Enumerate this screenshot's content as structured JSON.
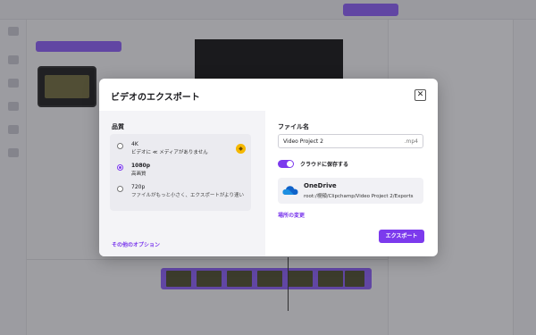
{
  "background_app": {
    "colors": {
      "accent": "#8b5cf6",
      "preview_bg": "#111111"
    }
  },
  "dialog": {
    "title": "ビデオのエクスポート",
    "close_icon": "close-icon",
    "quality": {
      "label": "品質",
      "options": [
        {
          "title": "4K",
          "subtitle": "ビデオに ≪ メディアがありません",
          "selected": false,
          "premium_icon": "premium-gem-icon"
        },
        {
          "title": "1080p",
          "subtitle": "高画質",
          "selected": true
        },
        {
          "title": "720p",
          "subtitle": "ファイルがもっと小さく、エクスポートがより速い",
          "selected": false
        }
      ],
      "more_options": "その他のオプション"
    },
    "filename": {
      "label": "ファイル名",
      "value": "Video Project 2",
      "extension": ".mp4"
    },
    "cloud_save": {
      "label": "クラウドに保存する",
      "enabled": true
    },
    "location": {
      "icon": "onedrive-cloud-icon",
      "name": "OneDrive",
      "path": "root:/視頻/Clipchamp/Video Project 2/Exports"
    },
    "change_location": "場所の変更",
    "export_button": "エクスポート",
    "colors": {
      "accent": "#7c3aed",
      "premium": "#f5b800"
    }
  }
}
